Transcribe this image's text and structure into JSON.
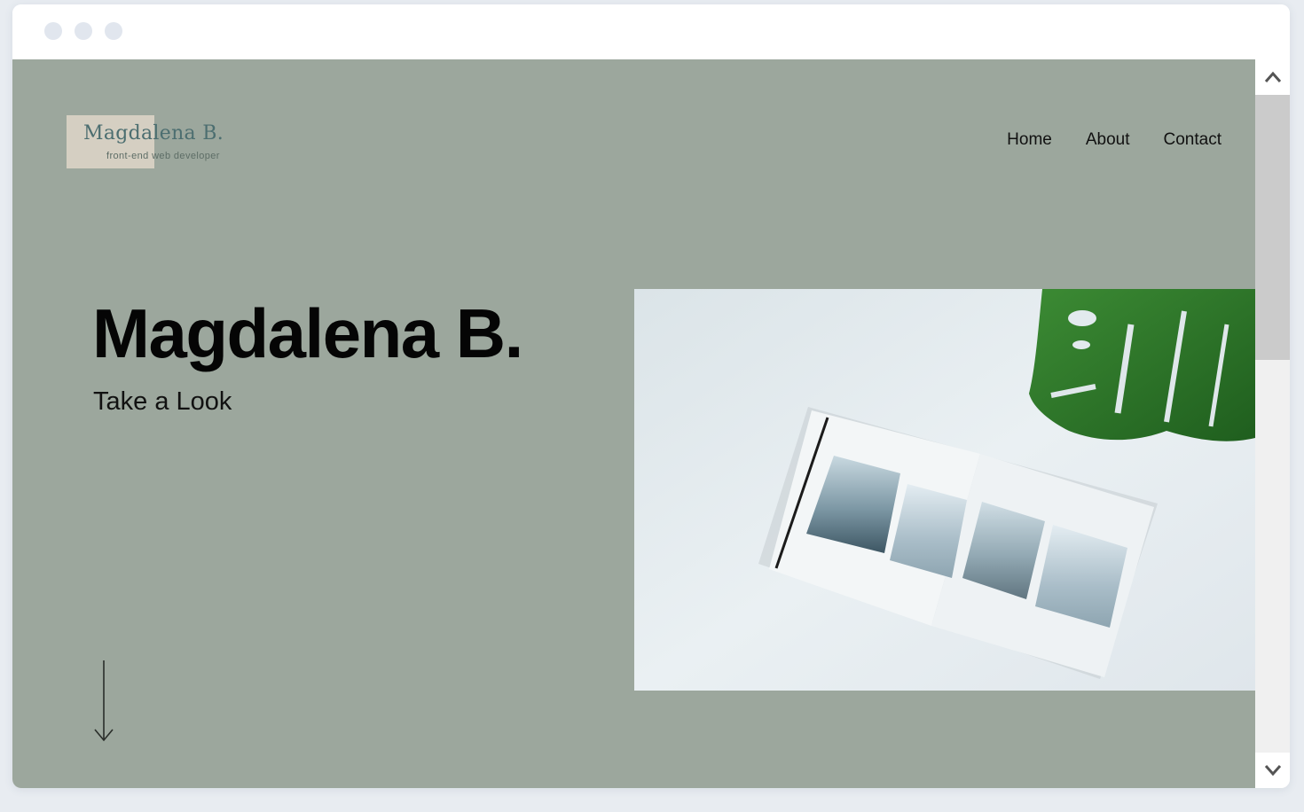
{
  "site": {
    "logo": {
      "name": "Magdalena B.",
      "tagline": "front-end web developer"
    },
    "nav": [
      {
        "label": "Home"
      },
      {
        "label": "About"
      },
      {
        "label": "Contact"
      }
    ],
    "hero": {
      "title": "Magdalena B.",
      "subtitle": "Take a Look",
      "scroll_icon": "arrow-down-icon",
      "image": "open-magazine-with-wave-photos-and-monstera-leaf"
    }
  },
  "browser": {
    "window_dots": [
      "dot",
      "dot",
      "dot"
    ],
    "scroll_up_icon": "chevron-up-icon",
    "scroll_down_icon": "chevron-down-icon"
  },
  "colors": {
    "page_background": "#9ca79d",
    "logo_block": "#d8d1c4",
    "logo_text": "#4c6e70",
    "text": "#050505",
    "leaf": "#2f7a2a"
  }
}
